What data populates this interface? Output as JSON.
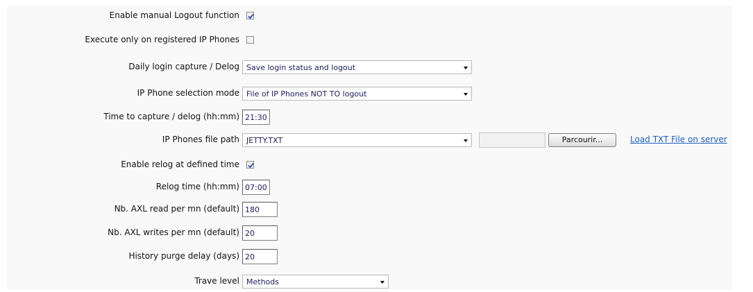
{
  "form": {
    "logout_enable": {
      "label": "Enable manual Logout function",
      "checked": true
    },
    "registered_only": {
      "label": "Execute only on registered IP Phones",
      "checked": false
    },
    "daily_capture": {
      "label": "Daily login capture / Delog",
      "value": "Save login status and logout"
    },
    "selection_mode": {
      "label": "IP Phone selection mode",
      "value": "File of IP Phones NOT TO logout"
    },
    "capture_time": {
      "label": "Time to capture / delog (hh:mm)",
      "value": "21:30"
    },
    "file_path": {
      "label": "IP Phones file path",
      "value": "JETTY.TXT",
      "browse_label": "Parcourir...",
      "load_link": "Load TXT File on server"
    },
    "relog_enable": {
      "label": "Enable relog at defined time",
      "checked": true
    },
    "relog_time": {
      "label": "Relog time (hh:mm)",
      "value": "07:00"
    },
    "axl_read": {
      "label": "Nb. AXL read per mn (default)",
      "value": "180"
    },
    "axl_writes": {
      "label": "Nb. AXL writes per mn (default)",
      "value": "20"
    },
    "purge_delay": {
      "label": "History purge delay (days)",
      "value": "20"
    },
    "trace_level": {
      "label": "Trave level",
      "value": "Methods"
    }
  },
  "icons": {
    "checkbox_check": "check-icon",
    "dropdown": "chevron-down-icon"
  },
  "colors": {
    "link": "#1e5fbf",
    "field_text": "#1b1b60",
    "panel_bg": "#f9f9f9"
  }
}
